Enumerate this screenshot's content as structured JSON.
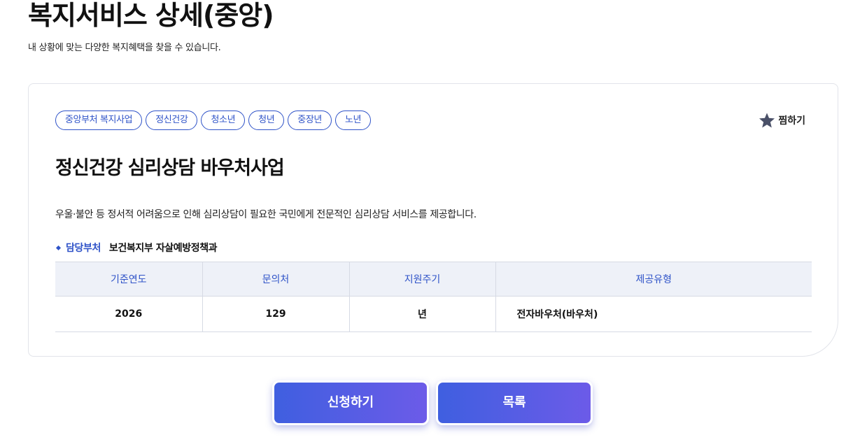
{
  "header": {
    "title": "복지서비스 상세(중앙)",
    "subtitle": "내 상황에 맞는 다양한 복지혜택을 찾을 수 있습니다."
  },
  "service": {
    "tags": [
      "중앙부처 복지사업",
      "정신건강",
      "청소년",
      "청년",
      "중장년",
      "노년"
    ],
    "favorite_label": "찜하기",
    "favorite_icon": "star-icon",
    "title": "정신건강 심리상담 바우처사업",
    "description": "우울·불안 등 정서적 어려움으로 인해 심리상담이 필요한 국민에게 전문적인 심리상담 서비스를 제공합니다.",
    "department_label": "담당부처",
    "department_value": "보건복지부 자살예방정책과"
  },
  "info_table": {
    "headers": [
      "기준연도",
      "문의처",
      "지원주기",
      "제공유형"
    ],
    "row": [
      "2026",
      "129",
      "년",
      "전자바우처(바우처)"
    ]
  },
  "buttons": {
    "apply_label": "신청하기",
    "list_label": "목록"
  },
  "colors": {
    "accent": "#2f53c8",
    "button_gradient_start": "#3f5fe0",
    "button_gradient_end": "#6c5be8"
  }
}
